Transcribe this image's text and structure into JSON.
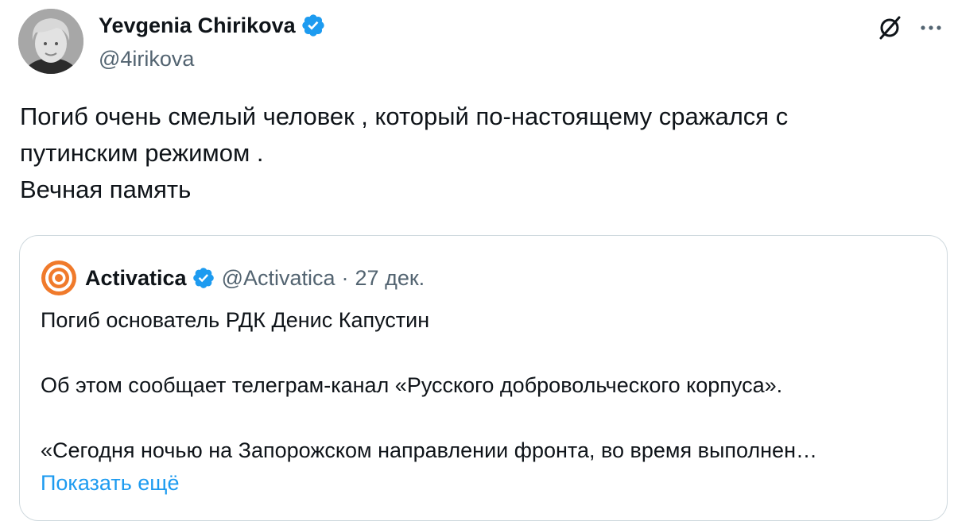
{
  "author": {
    "name": "Yevgenia Chirikova",
    "handle": "@4irikova",
    "verified_color": "#1d9bf0"
  },
  "icons": {
    "grok": "grok-icon",
    "more": "more-icon"
  },
  "tweet": {
    "lines": [
      "Погиб очень смелый человек , который по-настоящему сражался с",
      "путинским режимом .",
      "Вечная память"
    ]
  },
  "quote": {
    "name": "Activatica",
    "handle": "@Activatica",
    "separator": "·",
    "date": "27 дек.",
    "paragraphs": [
      "Погиб основатель РДК Денис Капустин",
      "Об этом сообщает телеграм-канал «Русского добровольческого корпуса».",
      "«Сегодня ночью на Запорожском направлении фронта, во время выполнен…"
    ],
    "show_more": "Показать ещё",
    "logo_color": "#f07a2b"
  },
  "colors": {
    "text": "#0f1419",
    "secondary": "#536471",
    "link": "#1d9bf0",
    "border": "#cfd9de"
  }
}
